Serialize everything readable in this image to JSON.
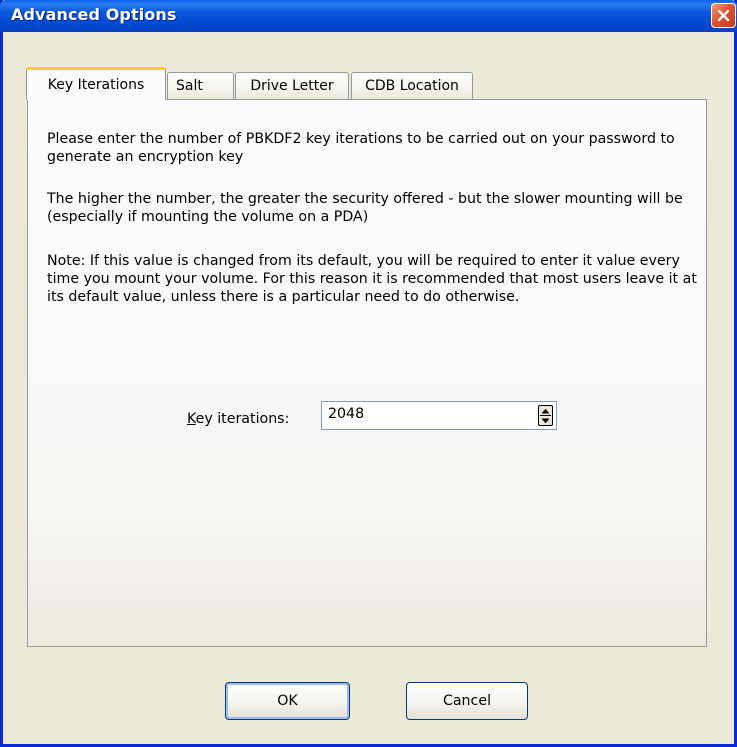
{
  "window": {
    "title": "Advanced Options"
  },
  "tabs": [
    {
      "label": "Key Iterations",
      "active": true
    },
    {
      "label": "Salt",
      "active": false
    },
    {
      "label": "Drive Letter",
      "active": false
    },
    {
      "label": "CDB Location",
      "active": false
    }
  ],
  "panel": {
    "paragraphs": [
      "Please enter the number of PBKDF2 key iterations to be carried out on your password to generate an encryption key",
      "The higher the number, the greater the security offered - but the slower mounting will be (especially if mounting the volume on a PDA)",
      "Note: If this value is changed from its default, you will be required to enter it value every time you mount your volume. For this reason it is recommended that most users leave it at its default value, unless there is a particular need to do otherwise."
    ],
    "key_iterations_label_accel": "K",
    "key_iterations_label_rest": "ey iterations:",
    "key_iterations_value": "2048"
  },
  "buttons": {
    "ok": "OK",
    "cancel": "Cancel"
  },
  "colors": {
    "title_bar": "#0a5fe7",
    "close_button": "#e0532e",
    "active_tab_highlight": "#ffc83c",
    "dialog_face": "#ece9d8"
  },
  "icons": {
    "close": "close-icon",
    "spin_up": "spin-up-arrow-icon",
    "spin_down": "spin-down-arrow-icon"
  }
}
